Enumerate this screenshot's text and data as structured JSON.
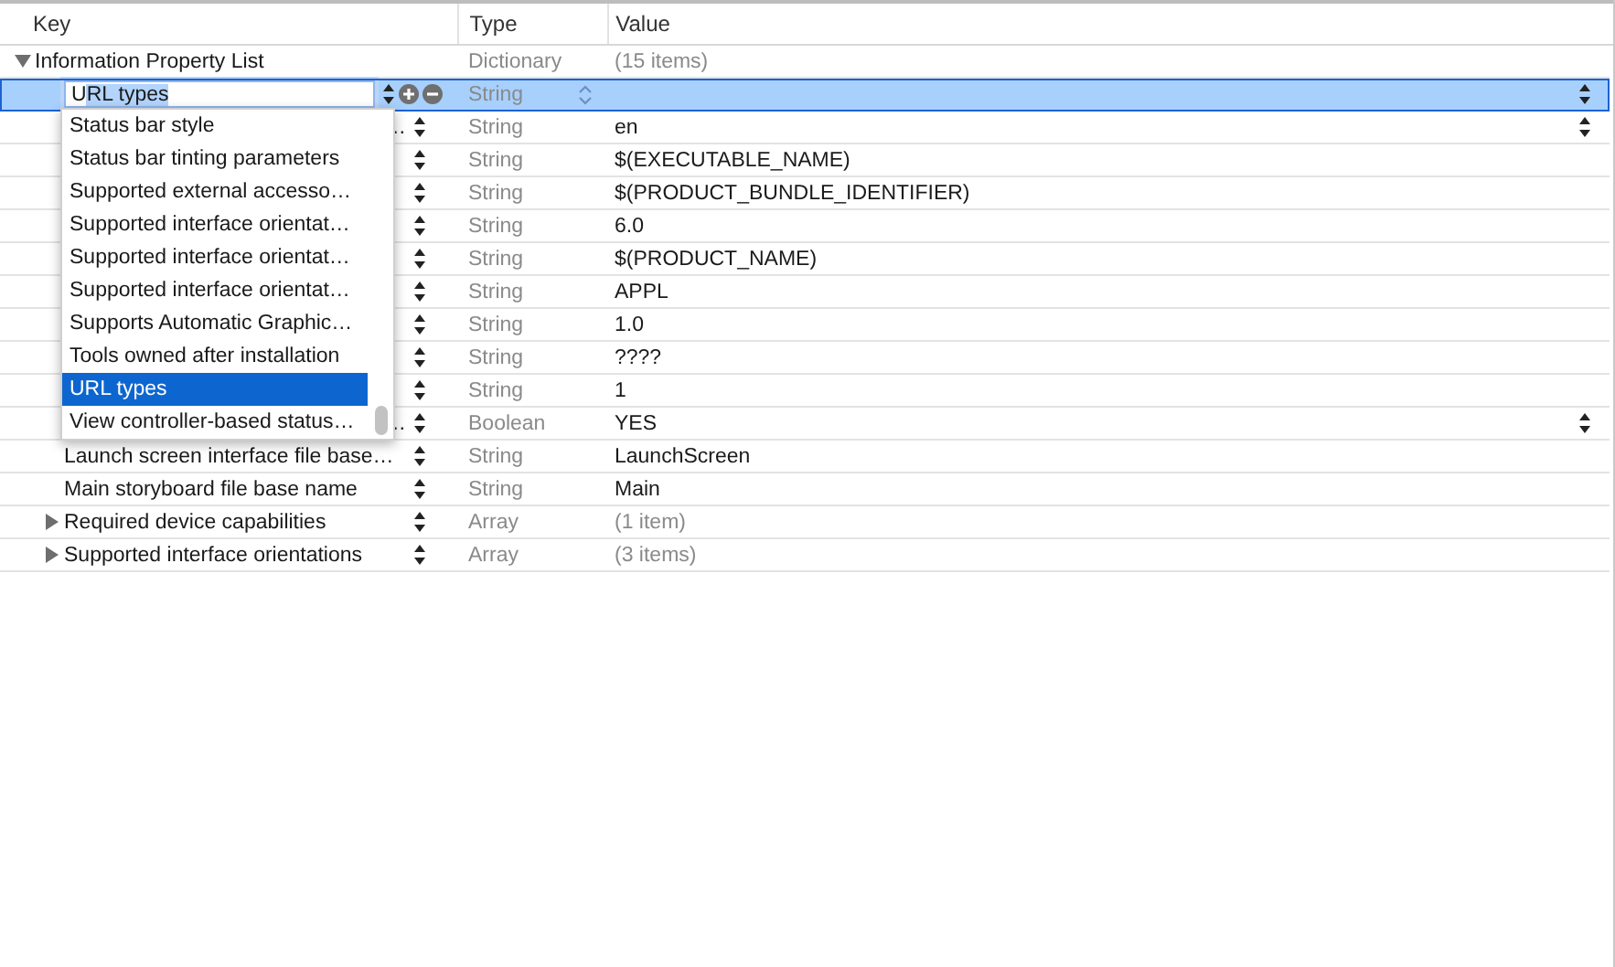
{
  "columns": [
    "Key",
    "Type",
    "Value"
  ],
  "root": {
    "key": "Information Property List",
    "type": "Dictionary",
    "value": "(15 items)",
    "expanded": true,
    "children": [
      {
        "key": "URL types",
        "type": "String",
        "selected": true,
        "covered": false,
        "value_popup": true,
        "expandable": false
      },
      {
        "key": "…",
        "type": "String",
        "value": "en",
        "selected": false,
        "covered": true,
        "value_popup": true,
        "expandable": false
      },
      {
        "type": "String",
        "value": "$(EXECUTABLE_NAME)",
        "selected": false,
        "value_popup": false,
        "expandable": false
      },
      {
        "type": "String",
        "value": "$(PRODUCT_BUNDLE_IDENTIFIER)",
        "selected": false,
        "value_popup": false,
        "expandable": false
      },
      {
        "type": "String",
        "value": "6.0",
        "selected": false,
        "value_popup": false,
        "expandable": false
      },
      {
        "type": "String",
        "value": "$(PRODUCT_NAME)",
        "selected": false,
        "value_popup": false,
        "expandable": false
      },
      {
        "type": "String",
        "value": "APPL",
        "selected": false,
        "value_popup": false,
        "expandable": false
      },
      {
        "type": "String",
        "value": "1.0",
        "selected": false,
        "value_popup": false,
        "expandable": false
      },
      {
        "type": "String",
        "value": "????",
        "selected": false,
        "value_popup": false,
        "expandable": false
      },
      {
        "type": "String",
        "value": "1",
        "selected": false,
        "value_popup": false,
        "expandable": false
      },
      {
        "key": "…",
        "type": "Boolean",
        "value": "YES",
        "selected": false,
        "covered": true,
        "value_popup": true,
        "expandable": false
      },
      {
        "key": "Launch screen interface file base…",
        "type": "String",
        "value": "LaunchScreen",
        "selected": false,
        "covered": false,
        "value_popup": false,
        "expandable": false
      },
      {
        "key": "Main storyboard file base name",
        "type": "String",
        "value": "Main",
        "selected": false,
        "covered": false,
        "value_popup": false,
        "expandable": false
      },
      {
        "key": "Required device capabilities",
        "type": "Array",
        "value": "(1 item)",
        "selected": false,
        "covered": false,
        "value_popup": false,
        "expandable": true
      },
      {
        "key": "Supported interface orientations",
        "type": "Array",
        "value": "(3 items)",
        "selected": false,
        "covered": false,
        "value_popup": false,
        "expandable": true
      }
    ]
  },
  "dropdown": {
    "items": [
      {
        "label": "Status bar style",
        "selected": false
      },
      {
        "label": "Status bar tinting parameters",
        "selected": false
      },
      {
        "label": "Supported external accesso…",
        "selected": false
      },
      {
        "label": "Supported interface orientat…",
        "selected": false
      },
      {
        "label": "Supported interface orientat…",
        "selected": false
      },
      {
        "label": "Supported interface orientat…",
        "selected": false
      },
      {
        "label": "Supports Automatic Graphic…",
        "selected": false
      },
      {
        "label": "Tools owned after installation",
        "selected": false
      },
      {
        "label": "URL types",
        "selected": true
      },
      {
        "label": "View controller-based status…",
        "selected": false
      }
    ]
  }
}
